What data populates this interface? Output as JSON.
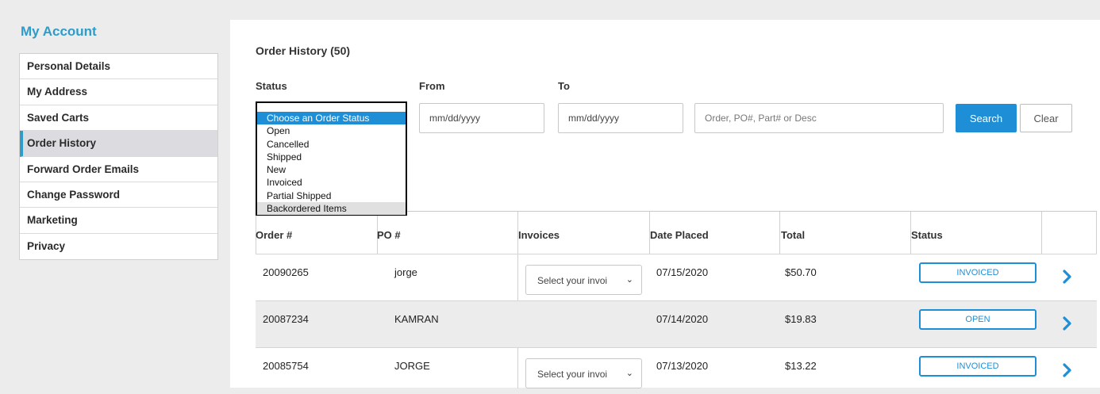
{
  "sidebar": {
    "title": "My Account",
    "items": [
      {
        "label": "Personal Details",
        "active": false
      },
      {
        "label": "My Address",
        "active": false
      },
      {
        "label": "Saved Carts",
        "active": false
      },
      {
        "label": "Order History",
        "active": true
      },
      {
        "label": "Forward Order Emails",
        "active": false
      },
      {
        "label": "Change Password",
        "active": false
      },
      {
        "label": "Marketing",
        "active": false
      },
      {
        "label": "Privacy",
        "active": false
      }
    ]
  },
  "page": {
    "title": "Order History (50)"
  },
  "filters": {
    "status_label": "Status",
    "from_label": "From",
    "to_label": "To",
    "from_placeholder": "mm/dd/yyyy",
    "to_placeholder": "mm/dd/yyyy",
    "search_placeholder": "Order, PO#, Part# or Desc",
    "search_button": "Search",
    "clear_button": "Clear",
    "status_options": [
      "Choose an Order Status",
      "Open",
      "Cancelled",
      "Shipped",
      "New",
      "Invoiced",
      "Partial Shipped",
      "Backordered Items"
    ]
  },
  "table": {
    "headers": {
      "order": "Order #",
      "po": "PO #",
      "invoices": "Invoices",
      "date": "Date Placed",
      "total": "Total",
      "status": "Status"
    },
    "invoice_select_placeholder": "Select your invoi",
    "rows": [
      {
        "order": "20090265",
        "po": "jorge",
        "has_invoice": true,
        "date": "07/15/2020",
        "total": "$50.70",
        "status": "INVOICED"
      },
      {
        "order": "20087234",
        "po": "KAMRAN",
        "has_invoice": false,
        "date": "07/14/2020",
        "total": "$19.83",
        "status": "OPEN"
      },
      {
        "order": "20085754",
        "po": "JORGE",
        "has_invoice": true,
        "date": "07/13/2020",
        "total": "$13.22",
        "status": "INVOICED"
      }
    ]
  },
  "colors": {
    "accent": "#1e8fd6",
    "sidebar_title": "#2f9bc8"
  }
}
